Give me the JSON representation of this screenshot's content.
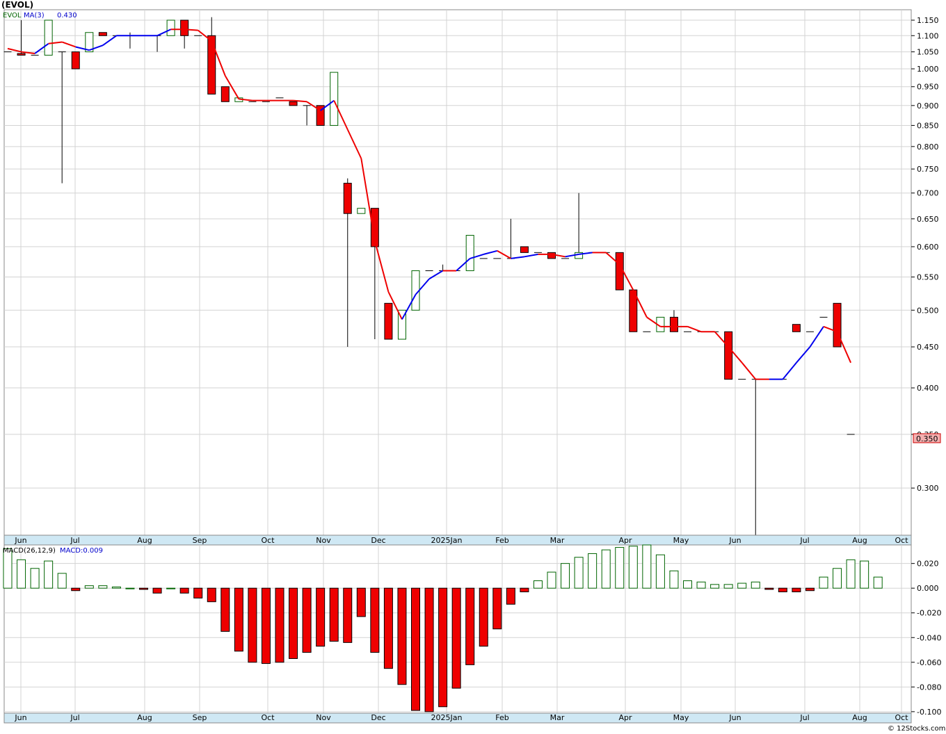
{
  "chart_data": [
    {
      "type": "candlestick",
      "title": "(EVOL)",
      "ticker_label": "EVOL",
      "indicator_label": "MA(3)",
      "indicator_value": "0.430",
      "last_price_label": "0.350",
      "y_scale": "log",
      "ylim": [
        0.262,
        1.185
      ],
      "grid": true,
      "y_ticks": [
        0.3,
        0.35,
        0.4,
        0.45,
        0.5,
        0.55,
        0.6,
        0.65,
        0.7,
        0.75,
        0.8,
        0.85,
        0.9,
        0.95,
        1.0,
        1.05,
        1.1,
        1.15
      ],
      "y_tick_labels": [
        "0.300",
        "0.350",
        "0.400",
        "0.450",
        "0.500",
        "0.550",
        "0.600",
        "0.650",
        "0.700",
        "0.750",
        "0.800",
        "0.850",
        "0.900",
        "0.950",
        "1.000",
        "1.050",
        "1.100",
        "1.150"
      ],
      "x_month_labels": [
        "Jun",
        "Jul",
        "Aug",
        "Sep",
        "Oct",
        "Nov",
        "Dec",
        "2025Jan",
        "Feb",
        "Mar",
        "Apr",
        "May",
        "Jun",
        "Jul",
        "Aug",
        "Oct"
      ],
      "candles": [
        {
          "o": 1.05,
          "h": 1.05,
          "l": 1.05,
          "c": 1.05
        },
        {
          "o": 1.045,
          "h": 1.15,
          "l": 1.04,
          "c": 1.04
        },
        {
          "o": 1.04,
          "h": 1.04,
          "l": 1.04,
          "c": 1.04
        },
        {
          "o": 1.04,
          "h": 1.15,
          "l": 1.04,
          "c": 1.15
        },
        {
          "o": 1.05,
          "h": 1.05,
          "l": 0.72,
          "c": 1.05
        },
        {
          "o": 1.05,
          "h": 1.05,
          "l": 1.0,
          "c": 1.0
        },
        {
          "o": 1.05,
          "h": 1.11,
          "l": 1.05,
          "c": 1.11
        },
        {
          "o": 1.11,
          "h": 1.11,
          "l": 1.1,
          "c": 1.1
        },
        {
          "o": 1.1,
          "h": 1.1,
          "l": 1.1,
          "c": 1.1
        },
        {
          "o": 1.1,
          "h": 1.11,
          "l": 1.06,
          "c": 1.1
        },
        {
          "o": 1.1,
          "h": 1.1,
          "l": 1.1,
          "c": 1.1
        },
        {
          "o": 1.1,
          "h": 1.1,
          "l": 1.05,
          "c": 1.1
        },
        {
          "o": 1.1,
          "h": 1.15,
          "l": 1.1,
          "c": 1.15
        },
        {
          "o": 1.15,
          "h": 1.15,
          "l": 1.06,
          "c": 1.1
        },
        {
          "o": 1.1,
          "h": 1.1,
          "l": 1.1,
          "c": 1.1
        },
        {
          "o": 1.1,
          "h": 1.16,
          "l": 0.93,
          "c": 0.93
        },
        {
          "o": 0.95,
          "h": 0.95,
          "l": 0.91,
          "c": 0.91
        },
        {
          "o": 0.91,
          "h": 0.92,
          "l": 0.91,
          "c": 0.92
        },
        {
          "o": 0.91,
          "h": 0.91,
          "l": 0.91,
          "c": 0.91
        },
        {
          "o": 0.91,
          "h": 0.91,
          "l": 0.91,
          "c": 0.91
        },
        {
          "o": 0.92,
          "h": 0.92,
          "l": 0.92,
          "c": 0.92
        },
        {
          "o": 0.91,
          "h": 0.91,
          "l": 0.9,
          "c": 0.9
        },
        {
          "o": 0.9,
          "h": 0.9,
          "l": 0.85,
          "c": 0.9
        },
        {
          "o": 0.9,
          "h": 0.9,
          "l": 0.85,
          "c": 0.85
        },
        {
          "o": 0.85,
          "h": 0.99,
          "l": 0.85,
          "c": 0.99
        },
        {
          "o": 0.72,
          "h": 0.73,
          "l": 0.45,
          "c": 0.66
        },
        {
          "o": 0.66,
          "h": 0.67,
          "l": 0.66,
          "c": 0.67
        },
        {
          "o": 0.67,
          "h": 0.67,
          "l": 0.46,
          "c": 0.6
        },
        {
          "o": 0.51,
          "h": 0.51,
          "l": 0.46,
          "c": 0.46
        },
        {
          "o": 0.46,
          "h": 0.5,
          "l": 0.46,
          "c": 0.5
        },
        {
          "o": 0.5,
          "h": 0.56,
          "l": 0.5,
          "c": 0.56
        },
        {
          "o": 0.56,
          "h": 0.56,
          "l": 0.56,
          "c": 0.56
        },
        {
          "o": 0.56,
          "h": 0.57,
          "l": 0.56,
          "c": 0.56
        },
        {
          "o": 0.56,
          "h": 0.56,
          "l": 0.56,
          "c": 0.56
        },
        {
          "o": 0.56,
          "h": 0.62,
          "l": 0.56,
          "c": 0.62
        },
        {
          "o": 0.58,
          "h": 0.58,
          "l": 0.58,
          "c": 0.58
        },
        {
          "o": 0.58,
          "h": 0.58,
          "l": 0.58,
          "c": 0.58
        },
        {
          "o": 0.58,
          "h": 0.65,
          "l": 0.58,
          "c": 0.58
        },
        {
          "o": 0.6,
          "h": 0.6,
          "l": 0.59,
          "c": 0.59
        },
        {
          "o": 0.59,
          "h": 0.59,
          "l": 0.59,
          "c": 0.59
        },
        {
          "o": 0.59,
          "h": 0.59,
          "l": 0.58,
          "c": 0.58
        },
        {
          "o": 0.58,
          "h": 0.58,
          "l": 0.58,
          "c": 0.58
        },
        {
          "o": 0.58,
          "h": 0.7,
          "l": 0.58,
          "c": 0.59
        },
        {
          "o": 0.59,
          "h": 0.59,
          "l": 0.59,
          "c": 0.59
        },
        {
          "o": 0.59,
          "h": 0.59,
          "l": 0.59,
          "c": 0.59
        },
        {
          "o": 0.59,
          "h": 0.59,
          "l": 0.53,
          "c": 0.53
        },
        {
          "o": 0.53,
          "h": 0.53,
          "l": 0.47,
          "c": 0.47
        },
        {
          "o": 0.47,
          "h": 0.47,
          "l": 0.47,
          "c": 0.47
        },
        {
          "o": 0.47,
          "h": 0.49,
          "l": 0.47,
          "c": 0.49
        },
        {
          "o": 0.49,
          "h": 0.5,
          "l": 0.47,
          "c": 0.47
        },
        {
          "o": 0.47,
          "h": 0.47,
          "l": 0.47,
          "c": 0.47
        },
        {
          "o": 0.47,
          "h": 0.47,
          "l": 0.47,
          "c": 0.47
        },
        {
          "o": 0.47,
          "h": 0.47,
          "l": 0.47,
          "c": 0.47
        },
        {
          "o": 0.47,
          "h": 0.47,
          "l": 0.41,
          "c": 0.41
        },
        {
          "o": 0.41,
          "h": 0.41,
          "l": 0.41,
          "c": 0.41
        },
        {
          "o": 0.41,
          "h": 0.41,
          "l": 0.26,
          "c": 0.41
        },
        {
          "o": 0.41,
          "h": 0.41,
          "l": 0.41,
          "c": 0.41
        },
        {
          "o": 0.41,
          "h": 0.41,
          "l": 0.41,
          "c": 0.41
        },
        {
          "o": 0.48,
          "h": 0.48,
          "l": 0.47,
          "c": 0.47
        },
        {
          "o": 0.47,
          "h": 0.47,
          "l": 0.47,
          "c": 0.47
        },
        {
          "o": 0.49,
          "h": 0.49,
          "l": 0.49,
          "c": 0.49
        },
        {
          "o": 0.51,
          "h": 0.51,
          "l": 0.45,
          "c": 0.45
        },
        {
          "o": 0.35,
          "h": 0.35,
          "l": 0.35,
          "c": 0.35
        }
      ],
      "ma_series": [
        {
          "v": 1.06,
          "up": true
        },
        {
          "v": 1.05,
          "up": false
        },
        {
          "v": 1.045,
          "up": false
        },
        {
          "v": 1.075,
          "up": true
        },
        {
          "v": 1.08,
          "up": false
        },
        {
          "v": 1.065,
          "up": false
        },
        {
          "v": 1.055,
          "up": true
        },
        {
          "v": 1.07,
          "up": true
        },
        {
          "v": 1.1,
          "up": true
        },
        {
          "v": 1.1,
          "up": true
        },
        {
          "v": 1.1,
          "up": true
        },
        {
          "v": 1.1,
          "up": true
        },
        {
          "v": 1.12,
          "up": true
        },
        {
          "v": 1.12,
          "up": false
        },
        {
          "v": 1.117,
          "up": false
        },
        {
          "v": 1.083,
          "up": false
        },
        {
          "v": 0.98,
          "up": false
        },
        {
          "v": 0.917,
          "up": false
        },
        {
          "v": 0.913,
          "up": false
        },
        {
          "v": 0.913,
          "up": false
        },
        {
          "v": 0.913,
          "up": false
        },
        {
          "v": 0.913,
          "up": false
        },
        {
          "v": 0.91,
          "up": false
        },
        {
          "v": 0.887,
          "up": false
        },
        {
          "v": 0.913,
          "up": true
        },
        {
          "v": 0.84,
          "up": false
        },
        {
          "v": 0.773,
          "up": false
        },
        {
          "v": 0.61,
          "up": false
        },
        {
          "v": 0.527,
          "up": false
        },
        {
          "v": 0.487,
          "up": false
        },
        {
          "v": 0.523,
          "up": true
        },
        {
          "v": 0.547,
          "up": true
        },
        {
          "v": 0.56,
          "up": true
        },
        {
          "v": 0.56,
          "up": false
        },
        {
          "v": 0.58,
          "up": true
        },
        {
          "v": 0.587,
          "up": true
        },
        {
          "v": 0.593,
          "up": true
        },
        {
          "v": 0.58,
          "up": false
        },
        {
          "v": 0.583,
          "up": true
        },
        {
          "v": 0.587,
          "up": true
        },
        {
          "v": 0.587,
          "up": false
        },
        {
          "v": 0.583,
          "up": false
        },
        {
          "v": 0.587,
          "up": true
        },
        {
          "v": 0.59,
          "up": true
        },
        {
          "v": 0.59,
          "up": false
        },
        {
          "v": 0.57,
          "up": false
        },
        {
          "v": 0.53,
          "up": false
        },
        {
          "v": 0.49,
          "up": false
        },
        {
          "v": 0.477,
          "up": false
        },
        {
          "v": 0.477,
          "up": false
        },
        {
          "v": 0.477,
          "up": false
        },
        {
          "v": 0.47,
          "up": false
        },
        {
          "v": 0.47,
          "up": false
        },
        {
          "v": 0.45,
          "up": false
        },
        {
          "v": 0.43,
          "up": false
        },
        {
          "v": 0.41,
          "up": false
        },
        {
          "v": 0.41,
          "up": false
        },
        {
          "v": 0.41,
          "up": true
        },
        {
          "v": 0.43,
          "up": true
        },
        {
          "v": 0.45,
          "up": true
        },
        {
          "v": 0.477,
          "up": true
        },
        {
          "v": 0.47,
          "up": false
        },
        {
          "v": 0.43,
          "up": false
        }
      ]
    },
    {
      "type": "bar",
      "title": "MACD(26,12,9)",
      "value_label": "MACD:0.009",
      "ylim": [
        -0.1012,
        0.035
      ],
      "grid": true,
      "y_ticks": [
        0.02,
        0.0,
        -0.02,
        -0.04,
        -0.06,
        -0.08,
        -0.1
      ],
      "y_tick_labels": [
        "0.020",
        "0.000",
        "-0.020",
        "-0.040",
        "-0.060",
        "-0.080",
        "-0.100"
      ],
      "x_month_labels": [
        "Jun",
        "Jul",
        "Aug",
        "Sep",
        "Oct",
        "Nov",
        "Dec",
        "2025Jan",
        "Feb",
        "Mar",
        "Apr",
        "May",
        "Jun",
        "Jul",
        "Aug",
        "Oct"
      ],
      "values": [
        0.032,
        0.023,
        0.016,
        0.022,
        0.012,
        -0.002,
        0.002,
        0.002,
        0.001,
        0.0,
        -0.001,
        -0.004,
        0.0,
        -0.004,
        -0.008,
        -0.011,
        -0.035,
        -0.051,
        -0.06,
        -0.061,
        -0.06,
        -0.057,
        -0.052,
        -0.047,
        -0.043,
        -0.044,
        -0.023,
        -0.052,
        -0.065,
        -0.078,
        -0.099,
        -0.1,
        -0.096,
        -0.081,
        -0.062,
        -0.047,
        -0.033,
        -0.013,
        -0.003,
        0.006,
        0.013,
        0.02,
        0.025,
        0.028,
        0.031,
        0.033,
        0.034,
        0.035,
        0.027,
        0.014,
        0.006,
        0.005,
        0.003,
        0.003,
        0.004,
        0.005,
        -0.001,
        -0.003,
        -0.003,
        -0.002,
        0.009,
        0.016,
        0.023,
        0.022,
        0.009
      ]
    }
  ],
  "colors": {
    "up": "#ffffff",
    "up_stroke": "#006400",
    "down": "#ee0000",
    "ma_up": "#0000ee",
    "ma_down": "#ee0000",
    "axis_band": "#cfe8f4",
    "grid": "#d3d3d3",
    "last_price_bg": "#f4b0b0"
  },
  "footer": "© 12Stocks.com"
}
